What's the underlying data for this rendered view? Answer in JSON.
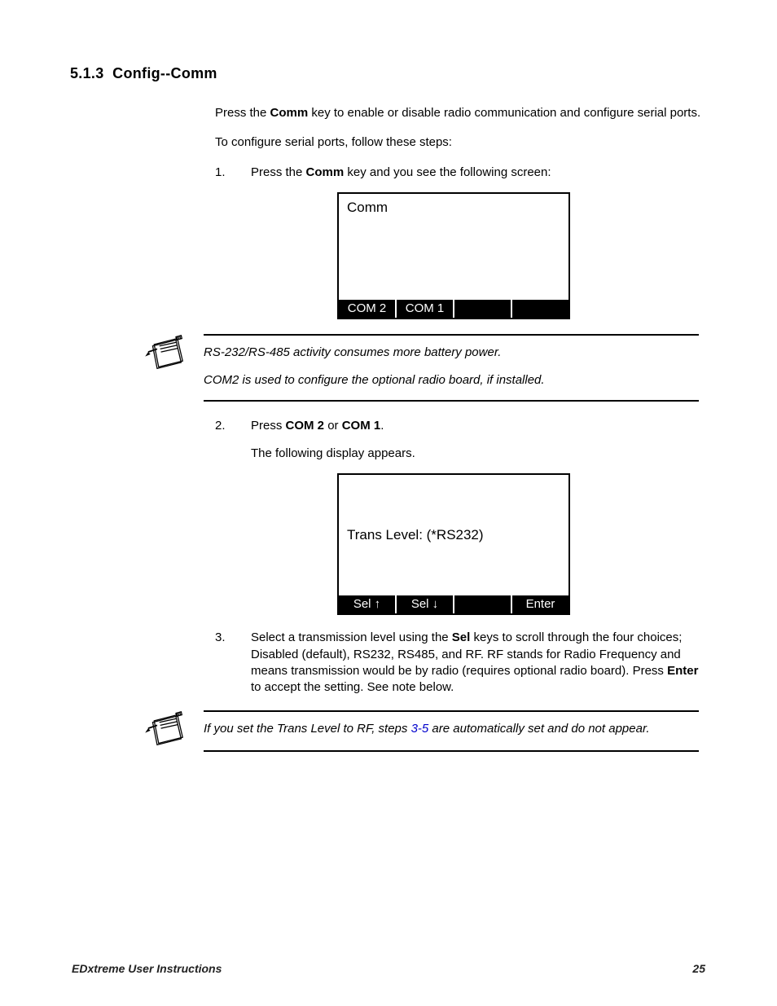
{
  "heading": {
    "number": "5.1.3",
    "title": "Config--Comm"
  },
  "intro": {
    "p1_pre": "Press the ",
    "p1_bold": "Comm",
    "p1_post": " key to enable or disable radio communication and configure serial ports.",
    "p2": "To configure serial ports, follow these steps:"
  },
  "step1": {
    "num": "1.",
    "pre": "Press the ",
    "bold": "Comm",
    "post": " key and you see the following screen:"
  },
  "screen1": {
    "title": "Comm",
    "sk1": "COM 2",
    "sk2": "COM 1",
    "sk3": "",
    "sk4": ""
  },
  "note1": {
    "line1": "RS-232/RS-485 activity consumes more battery power.",
    "line2": "COM2 is used to configure the optional radio board, if installed."
  },
  "step2": {
    "num": "2.",
    "pre": "Press ",
    "b1": "COM 2",
    "mid": " or ",
    "b2": "COM 1",
    "post": ".",
    "sub": "The following display appears."
  },
  "screen2": {
    "line": "Trans Level:  (*RS232)",
    "sk1": "Sel ↑",
    "sk2": "Sel ↓",
    "sk3": "",
    "sk4": "Enter"
  },
  "step3": {
    "num": "3.",
    "pre": "Select a transmission level using the ",
    "b1": "Sel",
    "mid": " keys to scroll through the four choices; Disabled (default), RS232, RS485, and RF. RF stands for Radio Frequency and means transmission would be by radio (requires optional radio board). Press ",
    "b2": "Enter",
    "post": " to accept the setting. See note below."
  },
  "note2": {
    "pre": "If you set the Trans Level to RF, steps ",
    "link": "3-5",
    "post": " are automatically set and do not appear."
  },
  "footer": {
    "left": "EDxtreme User Instructions",
    "right": "25"
  }
}
